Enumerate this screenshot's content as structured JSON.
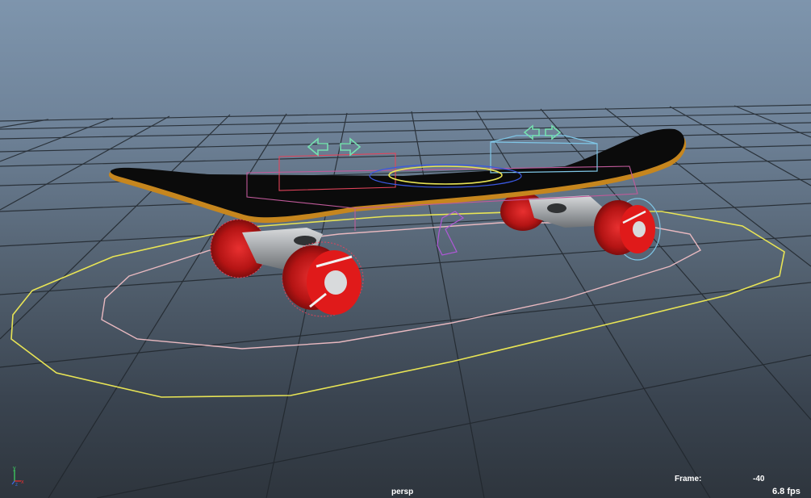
{
  "viewport": {
    "camera_name": "persp",
    "frame_label": "Frame:",
    "frame_value": "-40",
    "fps_value": "6.8 fps"
  },
  "colors": {
    "background_top": "#7e95ad",
    "background_bottom": "#2e353d",
    "grid_line": "#20262c",
    "deck": "#0b0b0b",
    "deck_edge": "#c6861e",
    "wheel": "#d01818",
    "truck": "#b5b8bc",
    "control_yellow": "#e8e455",
    "control_pink": "#e9b9c0",
    "control_red": "#e2445b",
    "control_cyan": "#7fc6e6",
    "control_blue": "#3a58e0",
    "control_purple": "#b058d8",
    "arrow_green": "#76e0b0"
  },
  "icons": {
    "axis_gizmo": "axis-gizmo-icon"
  }
}
